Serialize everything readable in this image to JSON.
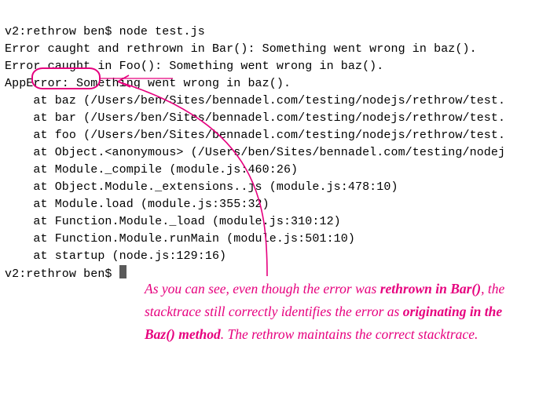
{
  "terminal": {
    "lines": [
      "v2:rethrow ben$ node test.js",
      "Error caught and rethrown in Bar(): Something went wrong in baz().",
      "Error caught in Foo(): Something went wrong in baz().",
      "AppError: Something went wrong in baz().",
      "    at baz (/Users/ben/Sites/bennadel.com/testing/nodejs/rethrow/test.",
      "    at bar (/Users/ben/Sites/bennadel.com/testing/nodejs/rethrow/test.",
      "    at foo (/Users/ben/Sites/bennadel.com/testing/nodejs/rethrow/test.",
      "    at Object.<anonymous> (/Users/ben/Sites/bennadel.com/testing/nodej",
      "    at Module._compile (module.js:460:26)",
      "    at Object.Module._extensions..js (module.js:478:10)",
      "    at Module.load (module.js:355:32)",
      "    at Function.Module._load (module.js:310:12)",
      "    at Function.Module.runMain (module.js:501:10)",
      "    at startup (node.js:129:16)"
    ],
    "prompt_final": "v2:rethrow ben$ "
  },
  "annotation": {
    "text_parts": [
      "As you can see, even though the error was ",
      "rethrown in Bar()",
      ", the stacktrace still correctly identifies the error as ",
      "originating in the Baz() method",
      ". The rethrow maintains the correct stacktrace."
    ]
  }
}
